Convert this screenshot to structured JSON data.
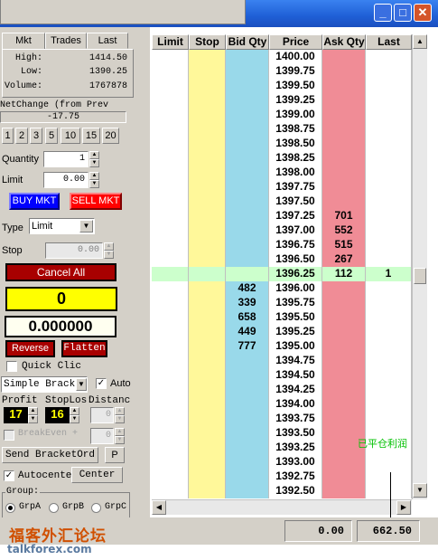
{
  "window": {
    "minimize_icon": "_",
    "maximize_icon": "□",
    "close_icon": "✕"
  },
  "tabs": [
    "Mkt",
    "Trades",
    "Last"
  ],
  "stats": {
    "high_label": "High:",
    "high": "1414.50",
    "low_label": "Low:",
    "low": "1390.25",
    "volume_label": "Volume:",
    "volume": "1767878"
  },
  "net_change": {
    "label": "NetChange (from Prev",
    "value": "-17.75"
  },
  "quantity_buttons": [
    "1",
    "2",
    "3",
    "5",
    "10",
    "15",
    "20"
  ],
  "order": {
    "quantity_label": "Quantity",
    "quantity": "1",
    "limit_label": "Limit",
    "limit": "0.00",
    "buy_label": "BUY MKT",
    "sell_label": "SELL MKT",
    "type_label": "Type",
    "type_value": "Limit",
    "stop_label": "Stop",
    "stop": "0.00"
  },
  "position": {
    "cancel_all_label": "Cancel All",
    "position": "0",
    "pnl": "0.000000",
    "reverse_label": "Reverse",
    "flatten_label": "Flatten",
    "quick_click_label": "Quick Clic"
  },
  "bracket": {
    "select_value": "Simple Bracke",
    "auto_label": "Auto",
    "profit_label": "Profit",
    "stoploss_label": "StopLos:",
    "distance_label": "Distanc",
    "profit": "17",
    "stoploss": "16",
    "distance": "0",
    "breakeven_label": "BreakEven +",
    "breakeven": "0",
    "send_label": "Send BracketOrd",
    "p_label": "P"
  },
  "center": {
    "autocenter_label": "Autocenter",
    "center_label": "Center"
  },
  "group": {
    "label": "Group:",
    "options": [
      "GrpA",
      "GrpB",
      "GrpC"
    ],
    "selected": "GrpA"
  },
  "ladder": {
    "headers": [
      "Limit",
      "Stop",
      "Bid Qty",
      "Price",
      "Ask Qty",
      "Last"
    ],
    "rows": [
      {
        "price": "1400.00",
        "bid": "",
        "ask": "",
        "last": ""
      },
      {
        "price": "1399.75",
        "bid": "",
        "ask": "",
        "last": ""
      },
      {
        "price": "1399.50",
        "bid": "",
        "ask": "",
        "last": ""
      },
      {
        "price": "1399.25",
        "bid": "",
        "ask": "",
        "last": ""
      },
      {
        "price": "1399.00",
        "bid": "",
        "ask": "",
        "last": ""
      },
      {
        "price": "1398.75",
        "bid": "",
        "ask": "",
        "last": ""
      },
      {
        "price": "1398.50",
        "bid": "",
        "ask": "",
        "last": ""
      },
      {
        "price": "1398.25",
        "bid": "",
        "ask": "",
        "last": ""
      },
      {
        "price": "1398.00",
        "bid": "",
        "ask": "",
        "last": ""
      },
      {
        "price": "1397.75",
        "bid": "",
        "ask": "",
        "last": ""
      },
      {
        "price": "1397.50",
        "bid": "",
        "ask": "",
        "last": ""
      },
      {
        "price": "1397.25",
        "bid": "",
        "ask": "701",
        "last": ""
      },
      {
        "price": "1397.00",
        "bid": "",
        "ask": "552",
        "last": ""
      },
      {
        "price": "1396.75",
        "bid": "",
        "ask": "515",
        "last": ""
      },
      {
        "price": "1396.50",
        "bid": "",
        "ask": "267",
        "last": ""
      },
      {
        "price": "1396.25",
        "bid": "",
        "ask": "112",
        "last": "1",
        "current": true
      },
      {
        "price": "1396.00",
        "bid": "482",
        "ask": "",
        "last": ""
      },
      {
        "price": "1395.75",
        "bid": "339",
        "ask": "",
        "last": ""
      },
      {
        "price": "1395.50",
        "bid": "658",
        "ask": "",
        "last": ""
      },
      {
        "price": "1395.25",
        "bid": "449",
        "ask": "",
        "last": ""
      },
      {
        "price": "1395.00",
        "bid": "777",
        "ask": "",
        "last": ""
      },
      {
        "price": "1394.75",
        "bid": "",
        "ask": "",
        "last": ""
      },
      {
        "price": "1394.50",
        "bid": "",
        "ask": "",
        "last": ""
      },
      {
        "price": "1394.25",
        "bid": "",
        "ask": "",
        "last": ""
      },
      {
        "price": "1394.00",
        "bid": "",
        "ask": "",
        "last": ""
      },
      {
        "price": "1393.75",
        "bid": "",
        "ask": "",
        "last": ""
      },
      {
        "price": "1393.50",
        "bid": "",
        "ask": "",
        "last": ""
      },
      {
        "price": "1393.25",
        "bid": "",
        "ask": "",
        "last": ""
      },
      {
        "price": "1393.00",
        "bid": "",
        "ask": "",
        "last": ""
      },
      {
        "price": "1392.75",
        "bid": "",
        "ask": "",
        "last": ""
      },
      {
        "price": "1392.50",
        "bid": "",
        "ask": "",
        "last": ""
      }
    ]
  },
  "status": {
    "field1": "0.00",
    "field2": "662.50"
  },
  "annotations": {
    "closed_pnl_cn": "已平仓利润"
  },
  "watermark": {
    "cn": "福客外汇论坛",
    "en": "talkforex.com"
  },
  "colors": {
    "bid": "#99d9ea",
    "ask": "#f08c96",
    "stop": "#fff89a",
    "current_row": "#ccffcc",
    "buy": "#0000ff",
    "sell": "#ff0000",
    "position_bg": "#ffff00",
    "title_bar": "#1f5fd6"
  }
}
